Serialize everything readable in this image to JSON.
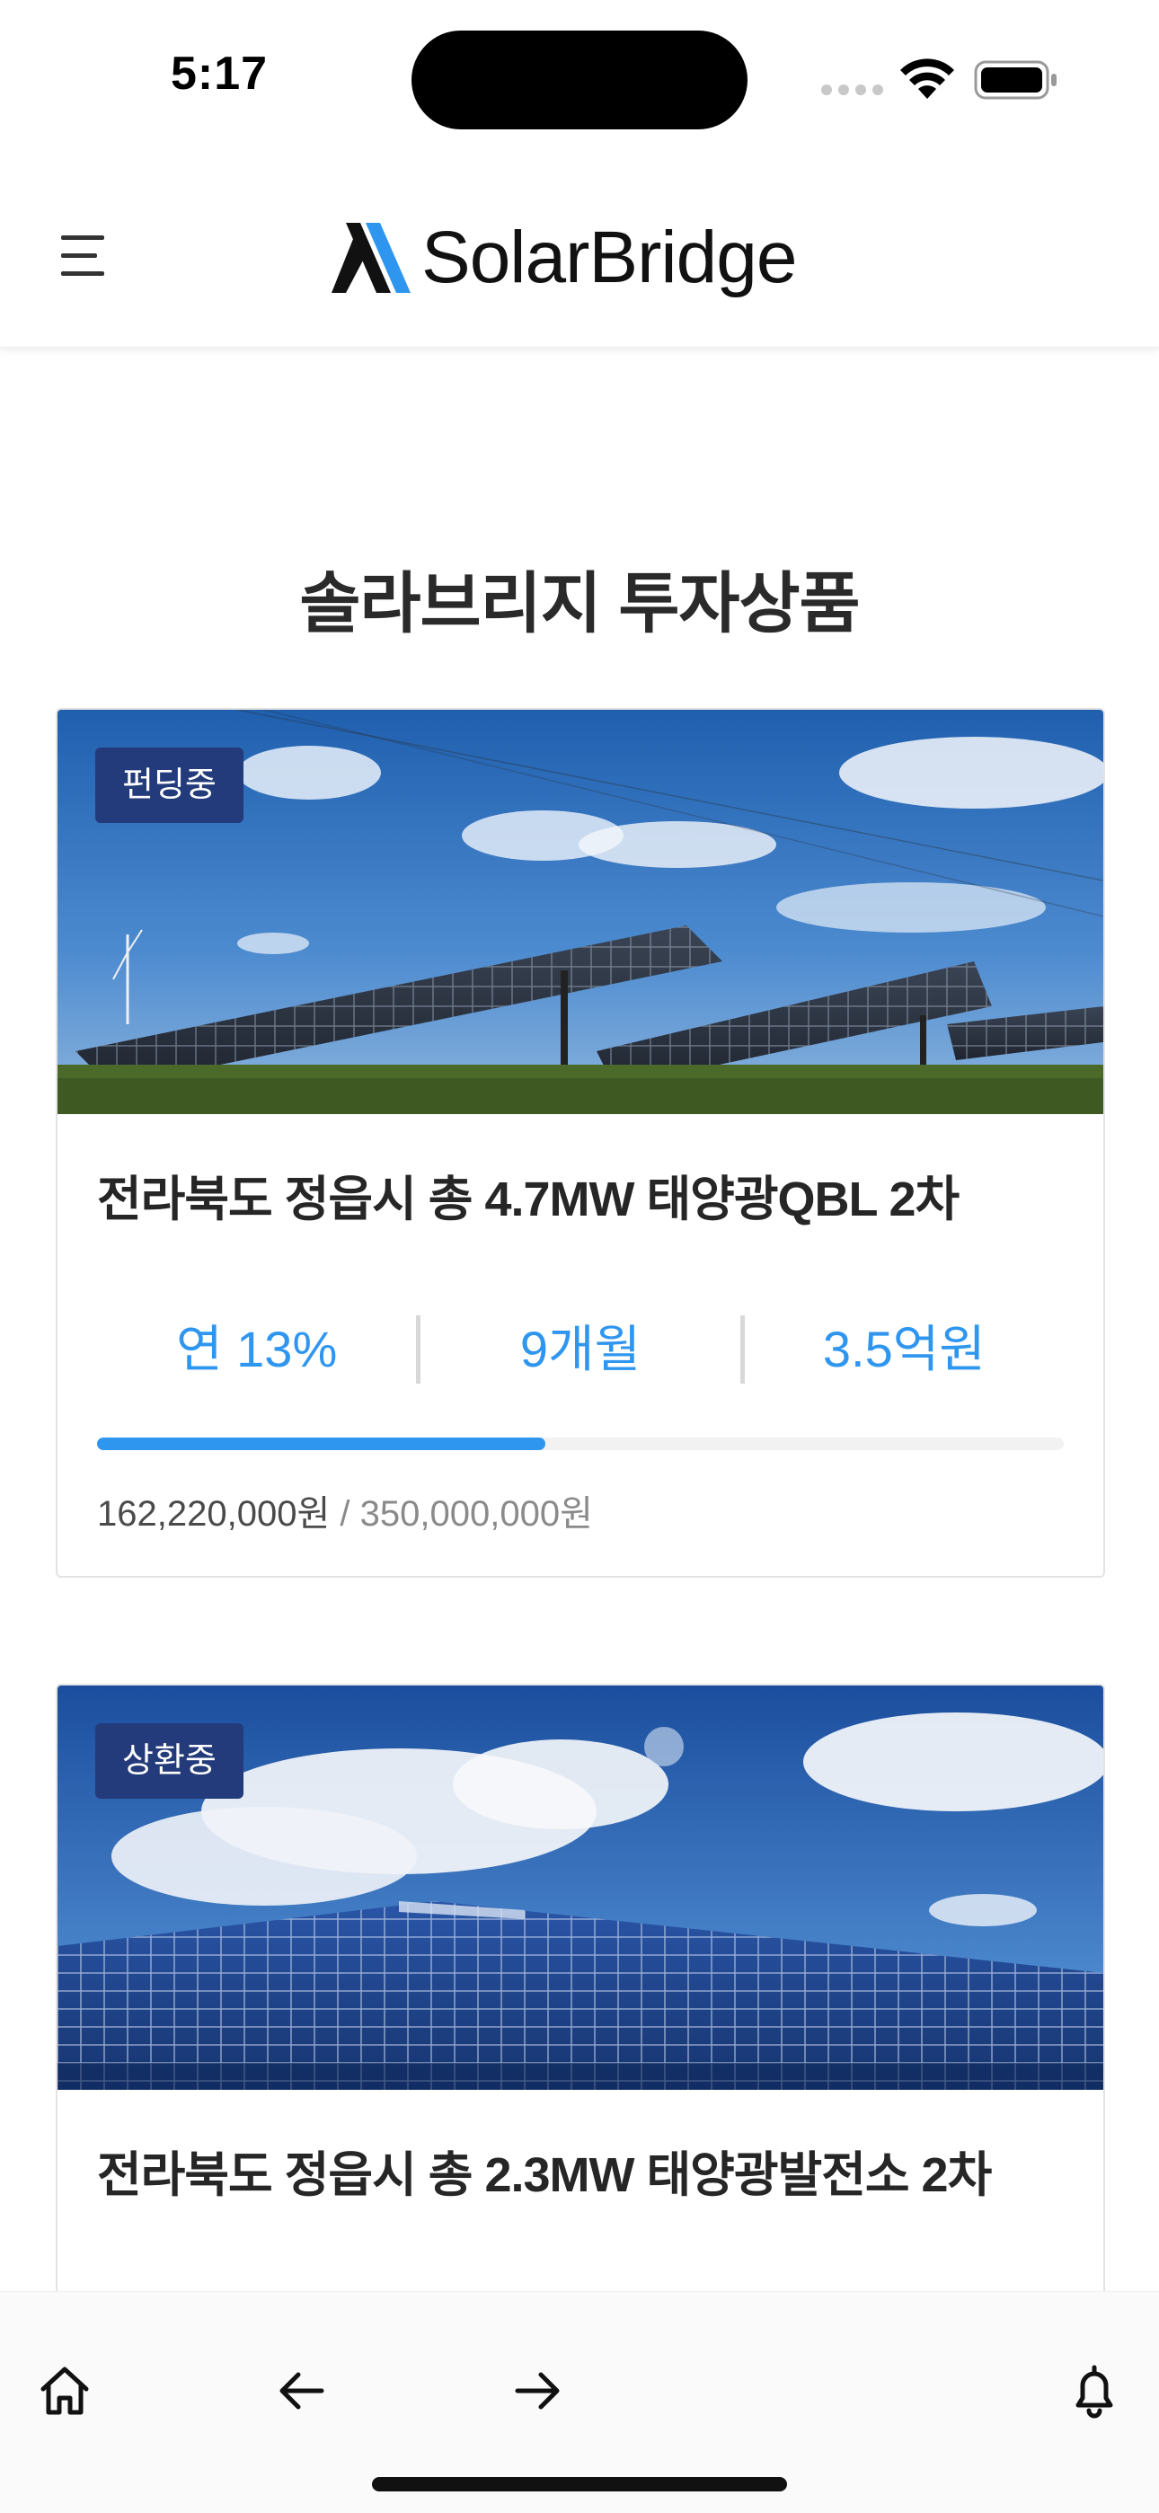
{
  "status_bar": {
    "time": "5:17"
  },
  "header": {
    "logo_text": "SolarBridge",
    "menu_icon": "hamburger-menu-icon"
  },
  "page": {
    "title": "솔라브리지 투자상품"
  },
  "products": [
    {
      "badge": "펀딩중",
      "title": "전라북도 정읍시 총 4.7MW 태양광QBL 2차",
      "rate": "연 13%",
      "period": "9개월",
      "amount": "3.5억원",
      "progress_fraction": 0.4635,
      "raised": "162,220,000원",
      "separator": "/",
      "goal": "350,000,000원"
    },
    {
      "badge": "상환중",
      "title": "전라북도 정읍시 총 2.3MW 태양광발전소 2차"
    }
  ],
  "bottom_nav": {
    "home_icon": "home-icon",
    "back_icon": "arrow-left-icon",
    "forward_icon": "arrow-right-icon",
    "notification_icon": "bell-icon"
  },
  "colors": {
    "accent": "#2f96f0",
    "badge": "#233b7a",
    "logo_blue": "#2f96f0"
  }
}
